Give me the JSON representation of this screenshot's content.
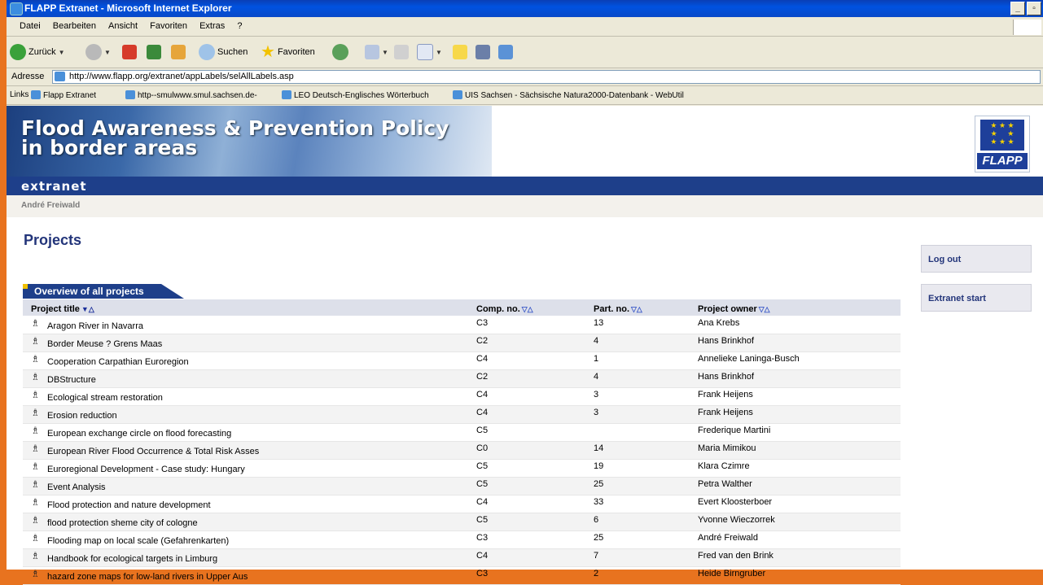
{
  "window": {
    "title": "FLAPP Extranet - Microsoft Internet Explorer"
  },
  "menu": [
    "Datei",
    "Bearbeiten",
    "Ansicht",
    "Favoriten",
    "Extras",
    "?"
  ],
  "toolbar": {
    "back_label": "Zurück",
    "search_label": "Suchen",
    "favorites_label": "Favoriten"
  },
  "address": {
    "label": "Adresse",
    "url": "http://www.flapp.org/extranet/appLabels/selAllLabels.asp"
  },
  "links": {
    "label": "Links",
    "items": [
      "Flapp Extranet",
      "http--smulwww.smul.sachsen.de-",
      "LEO Deutsch-Englisches Wörterbuch",
      "UIS Sachsen - Sächsische Natura2000-Datenbank - WebUtil"
    ]
  },
  "banner": {
    "title_line1": "Flood Awareness & Prevention Policy",
    "title_line2": "in border areas",
    "logo_text": "FLAPP",
    "section": "extranet"
  },
  "user": {
    "name": "André Freiwald"
  },
  "page": {
    "title": "Projects"
  },
  "sidebar": {
    "logout": "Log out",
    "start": "Extranet start"
  },
  "table": {
    "tab_label": "Overview of all projects",
    "columns": {
      "title": "Project title",
      "comp": "Comp. no.",
      "part": "Part. no.",
      "owner": "Project owner"
    },
    "rows": [
      {
        "title": "Aragon River in Navarra",
        "comp": "C3",
        "part": "13",
        "owner": "Ana Krebs"
      },
      {
        "title": "Border Meuse ? Grens Maas",
        "comp": "C2",
        "part": "4",
        "owner": "Hans Brinkhof"
      },
      {
        "title": "Cooperation Carpathian Euroregion",
        "comp": "C4",
        "part": "1",
        "owner": "Annelieke Laninga-Busch"
      },
      {
        "title": "DBStructure",
        "comp": "C2",
        "part": "4",
        "owner": "Hans Brinkhof"
      },
      {
        "title": "Ecological stream restoration",
        "comp": "C4",
        "part": "3",
        "owner": "Frank Heijens"
      },
      {
        "title": "Erosion reduction",
        "comp": "C4",
        "part": "3",
        "owner": "Frank Heijens"
      },
      {
        "title": "European exchange circle on flood forecasting",
        "comp": "C5",
        "part": "",
        "owner": "Frederique Martini"
      },
      {
        "title": "European River Flood Occurrence & Total Risk Asses",
        "comp": "C0",
        "part": "14",
        "owner": "Maria Mimikou"
      },
      {
        "title": "Euroregional Development - Case study: Hungary",
        "comp": "C5",
        "part": "19",
        "owner": "Klara Czimre"
      },
      {
        "title": "Event Analysis",
        "comp": "C5",
        "part": "25",
        "owner": "Petra Walther"
      },
      {
        "title": "Flood protection and nature development",
        "comp": "C4",
        "part": "33",
        "owner": "Evert Kloosterboer"
      },
      {
        "title": "flood protection sheme city of cologne",
        "comp": "C5",
        "part": "6",
        "owner": "Yvonne Wieczorrek"
      },
      {
        "title": "Flooding map on local scale (Gefahrenkarten)",
        "comp": "C3",
        "part": "25",
        "owner": "André Freiwald"
      },
      {
        "title": "Handbook for ecological targets in Limburg",
        "comp": "C4",
        "part": "7",
        "owner": "Fred van den Brink"
      },
      {
        "title": "hazard zone maps for low-land rivers in Upper Aus",
        "comp": "C3",
        "part": "2",
        "owner": "Heide Birngruber"
      }
    ]
  }
}
